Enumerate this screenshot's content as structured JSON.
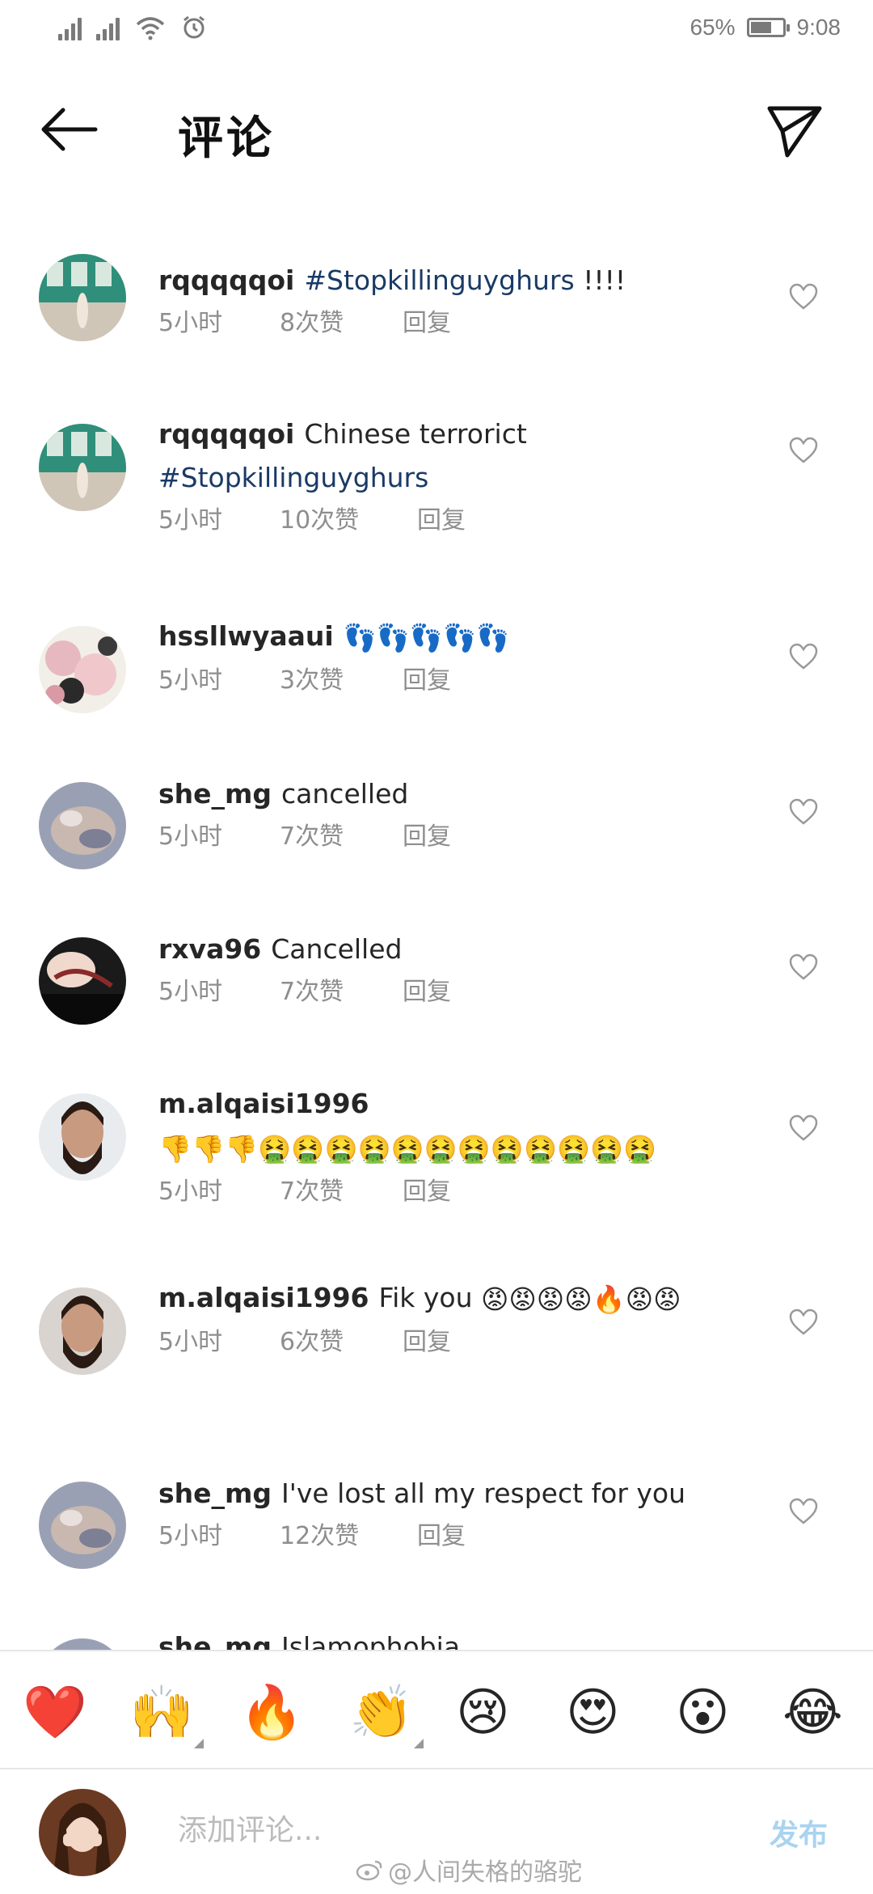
{
  "status_bar": {
    "battery": "65%",
    "battery_level": 0.65,
    "time": "9:08"
  },
  "header": {
    "title": "评论",
    "back_icon": "arrow-left-icon",
    "send_icon": "paper-plane-icon"
  },
  "partial_top_text": "...",
  "comments": [
    {
      "username": "rqqqqqoi",
      "text": "!!!!",
      "hashtag": "#Stopkillinguyghurs",
      "time": "5小时",
      "likes": "8次赞",
      "reply": "回复"
    },
    {
      "username": "rqqqqqoi",
      "text": "Chinese terrorict",
      "hashtag": "#Stopkillinguyghurs",
      "time": "5小时",
      "likes": "10次赞",
      "reply": "回复"
    },
    {
      "username": "hssllwyaaui",
      "text": "",
      "emojis": "👣👣👣👣👣",
      "time": "5小时",
      "likes": "3次赞",
      "reply": "回复"
    },
    {
      "username": "she_mg",
      "text": "cancelled",
      "time": "5小时",
      "likes": "7次赞",
      "reply": "回复"
    },
    {
      "username": "rxva96",
      "text": "Cancelled",
      "time": "5小时",
      "likes": "7次赞",
      "reply": "回复"
    },
    {
      "username": "m.alqaisi1996",
      "text": "",
      "emojis": "👎👎👎🤮🤮🤮🤮🤮🤮🤮🤮🤮🤮🤮🤮",
      "time": "5小时",
      "likes": "7次赞",
      "reply": "回复"
    },
    {
      "username": "m.alqaisi1996",
      "text": "Fik you",
      "emojis": "😡😡😡😡🔥😡😡",
      "time": "5小时",
      "likes": "6次赞",
      "reply": "回复"
    },
    {
      "username": "she_mg",
      "text": "I've lost all my respect for you",
      "time": "5小时",
      "likes": "12次赞",
      "reply": "回复"
    },
    {
      "username": "she_mg",
      "text": "Islamophobia"
    }
  ],
  "reactions": [
    "❤️",
    "🙌",
    "🔥",
    "👏",
    "😢",
    "😍",
    "😮",
    "😂"
  ],
  "composer": {
    "placeholder": "添加评论...",
    "post_label": "发布"
  },
  "watermark": "@人间失格的骆驼"
}
